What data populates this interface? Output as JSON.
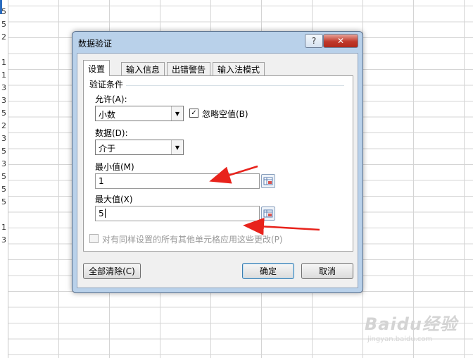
{
  "sheet": {
    "row_digits": [
      "5",
      "5",
      "2",
      "",
      "1",
      "1",
      "3",
      "3",
      "5",
      "2",
      "3",
      "5",
      "3",
      "5",
      "5",
      "5",
      "",
      "1",
      "3"
    ]
  },
  "dialog": {
    "title": "数据验证",
    "help_glyph": "?",
    "close_glyph": "✕",
    "tabs": [
      {
        "label": "设置"
      },
      {
        "label": "输入信息"
      },
      {
        "label": "出错警告"
      },
      {
        "label": "输入法模式"
      }
    ],
    "criteria": {
      "group_title": "验证条件",
      "allow_label": "允许(A):",
      "allow_value": "小数",
      "ignore_blank_label": "忽略空值(B)",
      "ignore_blank_checked": true,
      "data_label": "数据(D):",
      "data_value": "介于",
      "min_label": "最小值(M)",
      "min_value": "1",
      "max_label": "最大值(X)",
      "max_value": "5"
    },
    "apply_all_label": "对有同样设置的所有其他单元格应用这些更改(P)",
    "buttons": {
      "clear_all": "全部清除(C)",
      "ok": "确定",
      "cancel": "取消"
    }
  },
  "watermark": {
    "brand": "Baidu经验",
    "url": "jingyan.baidu.com"
  },
  "colors": {
    "arrow": "#e8231c",
    "dialog_frame": "#b9d1ea",
    "close_button": "#c0392b"
  }
}
